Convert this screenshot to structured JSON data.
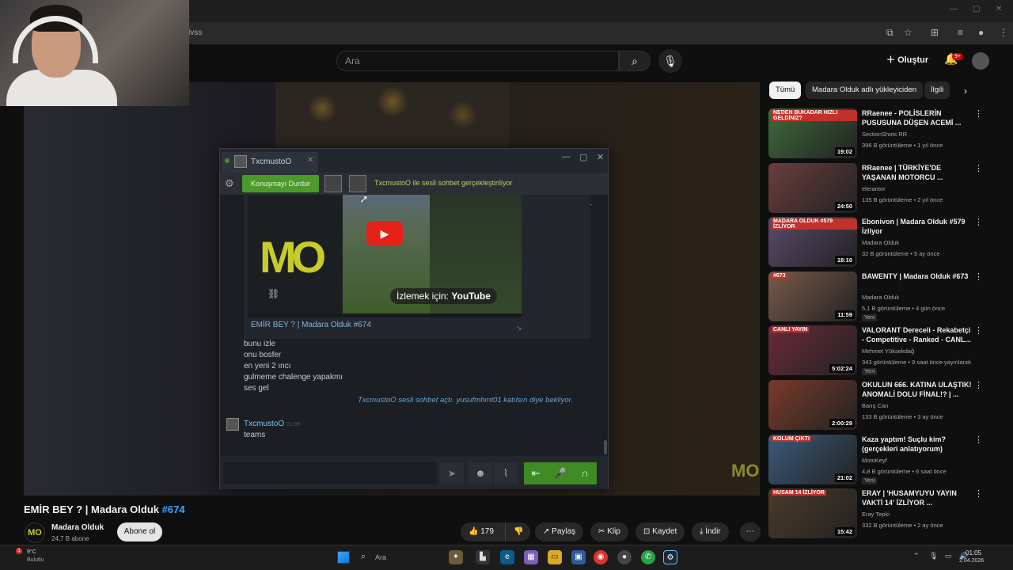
{
  "browser": {
    "url_fragment": "lvss"
  },
  "header": {
    "search_placeholder": "Ara",
    "create_label": "Oluştur",
    "notif_count": "9+"
  },
  "player": {
    "watermark": "MO"
  },
  "steam": {
    "tab_name": "TxcmustoO",
    "stop_label": "Konuşmayı Durdur",
    "voice_status": "TxcmustoO ile sesli sohbet gerçekleştiriliyor",
    "embed_logo": "MO",
    "watch_on": "İzlemek için:",
    "youtube": "YouTube",
    "embed_title": "EMİR BEY ? | Madara Olduk #674",
    "messages": [
      "bunu izle",
      "onu bosfer",
      "en yeni 2 ıncı",
      "gulmeme chalenge yapakmı",
      "ses gel"
    ],
    "system_msg": "TxcmustoO sesli sohbet açtı. yusufmhmt01 katılsın diye bekliyor.",
    "sender": "TxcmustoO",
    "sender_time": "01:05",
    "sender_msg": "teams"
  },
  "video": {
    "title": "EMİR BEY ? | Madara Olduk",
    "hashtag": "#674",
    "channel": "Madara Olduk",
    "channel_logo": "MO",
    "subs": "24,7 B abone",
    "subscribe": "Abone ol",
    "likes": "179",
    "share": "Paylaş",
    "clip": "Klip",
    "save": "Kaydet",
    "download": "İndir"
  },
  "sidebar": {
    "chips": [
      "Tümü",
      "Madara Olduk adlı yükleyiciden",
      "İlgili"
    ],
    "recs": [
      {
        "title": "RRaenee - POLİSLERİN PUSUSUNA DÜŞEN ACEMİ ...",
        "channel": "SectionShots RR",
        "meta": "396 B görüntüleme • 1 yıl önce",
        "dur": "19:02",
        "label": "NEDEN BUKADAR HIZLI GELDİNİZ?",
        "new": ""
      },
      {
        "title": "RRaenee | TÜRKİYE'DE YAŞANAN MOTORCU ...",
        "channel": "elerantor",
        "meta": "135 B görüntüleme • 2 yıl önce",
        "dur": "24:50",
        "label": "",
        "new": ""
      },
      {
        "title": "Ebonivon | Madara Olduk #579 İzliyor",
        "channel": "Madara Olduk",
        "meta": "32 B görüntüleme • 5 ay önce",
        "dur": "18:10",
        "label": "MADARA OLDUK #579 İZLİYOR",
        "new": ""
      },
      {
        "title": "BAWENTY | Madara Olduk #673",
        "channel": "Madara Olduk",
        "meta": "5,1 B görüntüleme • 4 gün önce",
        "dur": "11:59",
        "label": "#673",
        "new": "Yeni"
      },
      {
        "title": "VALORANT Dereceli - Rekabetçi - Competitive - Ranked - CANL...",
        "channel": "Mehmet Yüksekdağ",
        "meta": "343 görüntüleme • 9 saat önce yayınlandı",
        "dur": "5:02:24",
        "label": "CANLI YAYIN",
        "new": "Yeni"
      },
      {
        "title": "OKULUN 666. KATINA ULAŞTIK! ANOMALİ DOLU FİNAL!? | ...",
        "channel": "Barış Can",
        "meta": "133 B görüntüleme • 3 ay önce",
        "dur": "2:00:29",
        "label": "",
        "new": ""
      },
      {
        "title": "Kaza yaptım! Suçlu kim? (gerçekleri anlatıyorum)",
        "channel": "MotoKeyf",
        "meta": "4,8 B görüntüleme • 6 saat önce",
        "dur": "21:02",
        "label": "KOLUM ÇIKTI",
        "new": "Yeni"
      },
      {
        "title": "ERAY | 'HUSAMYUYU YAYIN VAKTİ 14' İZLİYOR ...",
        "channel": "Eray Tepki",
        "meta": "332 B görüntüleme • 2 ay önce",
        "dur": "15:42",
        "label": "HUSAM 14 İZLİYOR",
        "new": ""
      }
    ]
  },
  "taskbar": {
    "temp": "9°C",
    "weather": "Bulutlu",
    "search": "Ara",
    "time": "01:05",
    "date": "2.04.2026"
  }
}
